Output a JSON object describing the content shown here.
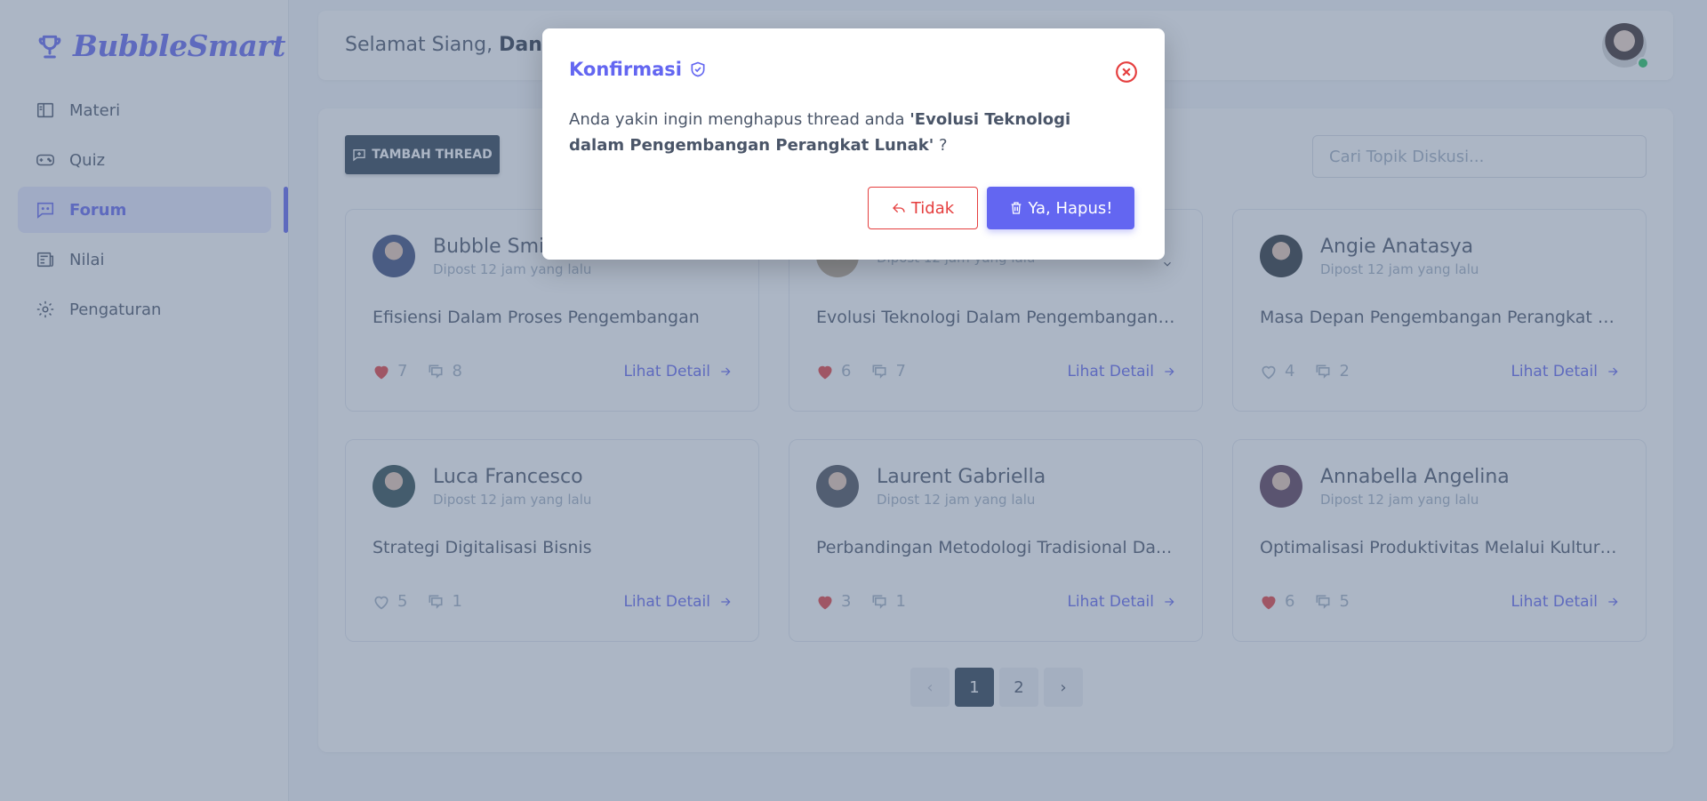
{
  "brand": {
    "name": "BubbleSmart"
  },
  "sidebar": {
    "items": [
      {
        "label": "Materi",
        "icon": "book-icon",
        "active": false
      },
      {
        "label": "Quiz",
        "icon": "gamepad-icon",
        "active": false
      },
      {
        "label": "Forum",
        "icon": "chat-icon",
        "active": true
      },
      {
        "label": "Nilai",
        "icon": "report-icon",
        "active": false
      },
      {
        "label": "Pengaturan",
        "icon": "gear-icon",
        "active": false
      }
    ]
  },
  "header": {
    "greeting": "Selamat Siang,",
    "user_name": "Daniel"
  },
  "forum": {
    "add_button": "TAMBAH THREAD",
    "search_placeholder": "Cari Topik Diskusi...",
    "detail_label": "Lihat Detail",
    "threads": [
      {
        "author": "Bubble Smith",
        "time": "Dipost 12 jam yang lalu",
        "title": "Efisiensi Dalam Proses Pengembangan",
        "likes": "7",
        "liked": true,
        "comments": "8",
        "avatar_color": "#3b4a7a"
      },
      {
        "author": "",
        "time": "Dipost 12 jam yang lalu",
        "title": "Evolusi Teknologi Dalam Pengembangan ...",
        "likes": "6",
        "liked": true,
        "comments": "7",
        "avatar_color": "#b9a68f"
      },
      {
        "author": "Angie Anatasya",
        "time": "Dipost 12 jam yang lalu",
        "title": "Masa Depan Pengembangan Perangkat L...",
        "likes": "4",
        "liked": false,
        "comments": "2",
        "avatar_color": "#2b3238"
      },
      {
        "author": "Luca Francesco",
        "time": "Dipost 12 jam yang lalu",
        "title": "Strategi Digitalisasi Bisnis",
        "likes": "5",
        "liked": false,
        "comments": "1",
        "avatar_color": "#2f4a4f"
      },
      {
        "author": "Laurent Gabriella",
        "time": "Dipost 12 jam yang lalu",
        "title": "Perbandingan Metodologi Tradisional Da...",
        "likes": "3",
        "liked": true,
        "comments": "1",
        "avatar_color": "#4a4f58"
      },
      {
        "author": "Annabella Angelina",
        "time": "Dipost 12 jam yang lalu",
        "title": "Optimalisasi Produktivitas Melalui Kultur ...",
        "likes": "6",
        "liked": true,
        "comments": "5",
        "avatar_color": "#5a3a55"
      }
    ]
  },
  "pagination": {
    "prev": "‹",
    "pages": [
      "1",
      "2"
    ],
    "current": "1",
    "next": "›"
  },
  "modal": {
    "title": "Konfirmasi",
    "message_prefix": "Anda yakin ingin menghapus thread anda",
    "thread_name": "'Evolusi Teknologi dalam Pengembangan Perangkat Lunak'",
    "message_suffix": "?",
    "cancel_label": "Tidak",
    "confirm_label": "Ya, Hapus!"
  },
  "colors": {
    "accent": "#6366f1",
    "danger": "#e53e3e",
    "dark": "#2c3e50",
    "like": "#e53e3e",
    "online": "#22c55e"
  }
}
